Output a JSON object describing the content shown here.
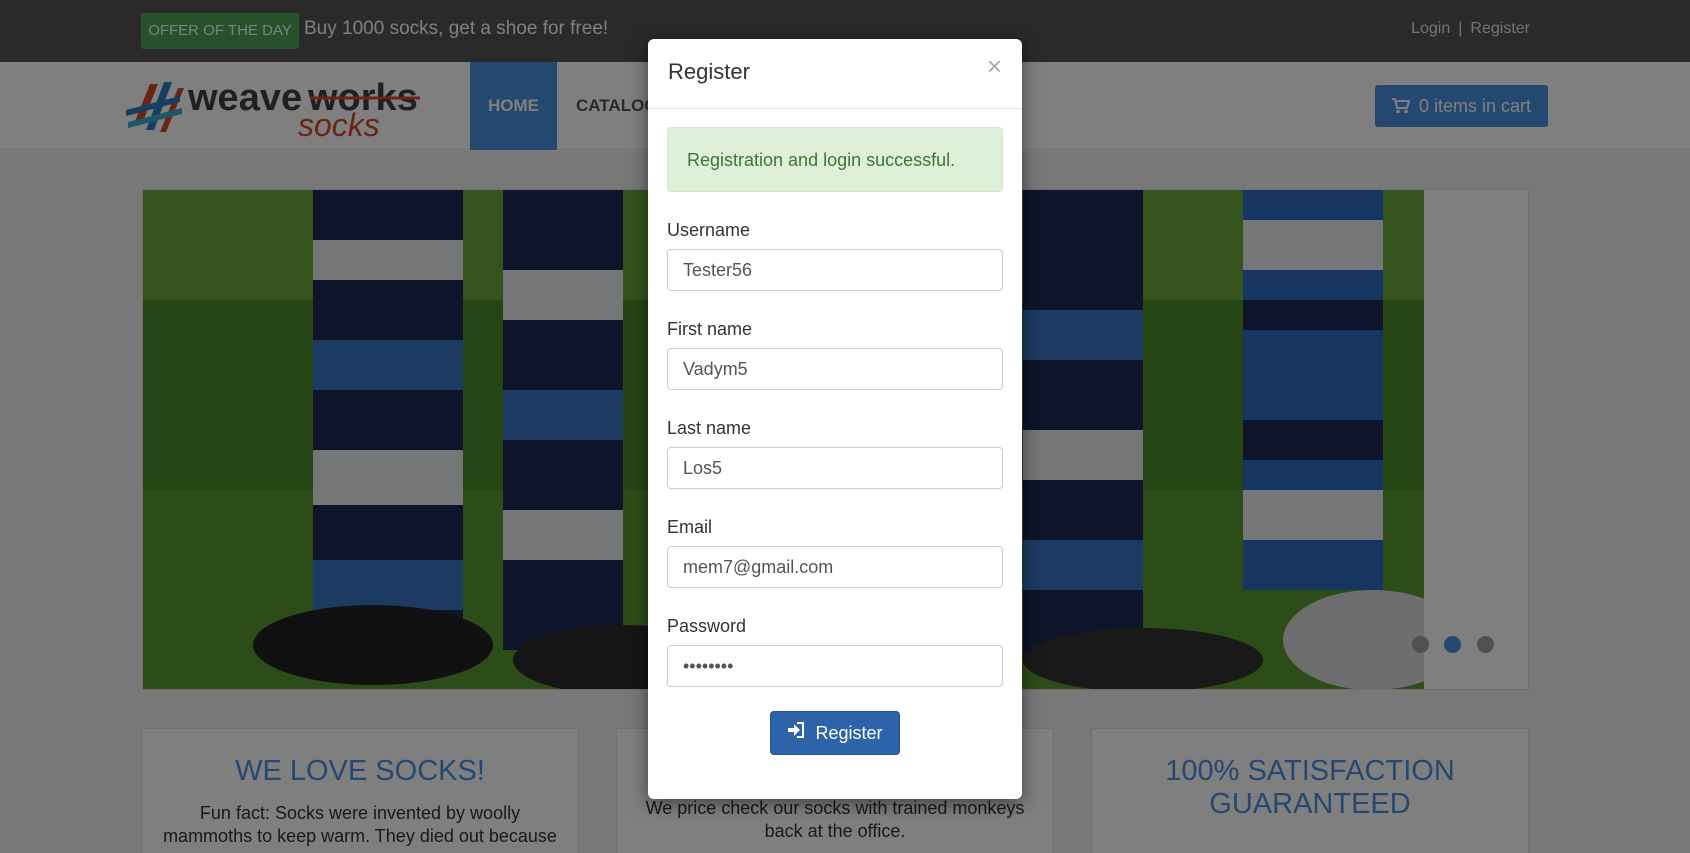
{
  "topbar": {
    "offer_badge": "OFFER OF THE DAY",
    "offer_text": "Buy 1000 socks, get a shoe for free!",
    "login_link": "Login",
    "separator": "|",
    "register_link": "Register"
  },
  "navbar": {
    "logo_alt": "weaveworks socks",
    "home": "HOME",
    "catalog": "CATALOG",
    "cart": "0 items in cart"
  },
  "carousel": {
    "slide_count": 3,
    "active_slide": 2
  },
  "boxes": [
    {
      "title": "WE LOVE SOCKS!",
      "text": "Fun fact: Socks were invented by woolly mammoths to keep warm. They died out because"
    },
    {
      "title": "",
      "text": "We price check our socks with trained monkeys back at the office."
    },
    {
      "title": "100% SATISFACTION GUARANTEED",
      "text": ""
    }
  ],
  "modal": {
    "title": "Register",
    "close": "×",
    "alert": "Registration and login successful.",
    "fields": [
      {
        "label": "Username",
        "value": "Tester56",
        "type": "text"
      },
      {
        "label": "First name",
        "value": "Vadym5",
        "type": "text"
      },
      {
        "label": "Last name",
        "value": "Los5",
        "type": "text"
      },
      {
        "label": "Email",
        "value": "mem7@gmail.com",
        "type": "text"
      },
      {
        "label": "Password",
        "value": "••••••••",
        "type": "password"
      }
    ],
    "submit_label": "Register"
  },
  "colors": {
    "topbar": "#555555",
    "offer_green": "#4fa356",
    "brand_blue": "#4a90e2",
    "button_blue": "#2d63a8",
    "alert_bg": "#dff0d8",
    "alert_text": "#3c763d"
  }
}
